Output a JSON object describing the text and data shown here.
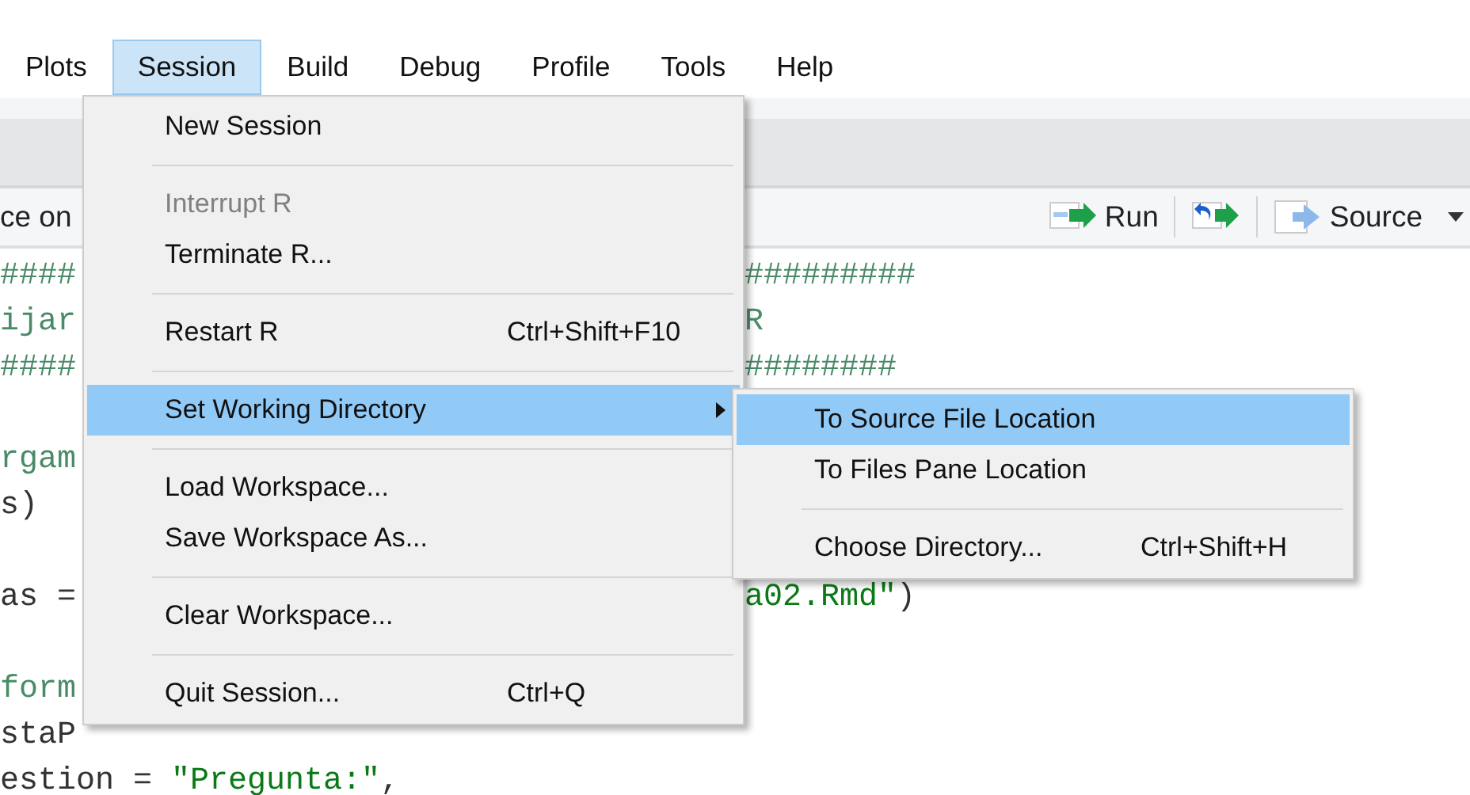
{
  "menubar": [
    {
      "label": "Plots",
      "selected": false
    },
    {
      "label": "Session",
      "selected": true
    },
    {
      "label": "Build",
      "selected": false
    },
    {
      "label": "Debug",
      "selected": false
    },
    {
      "label": "Profile",
      "selected": false
    },
    {
      "label": "Tools",
      "selected": false
    },
    {
      "label": "Help",
      "selected": false
    }
  ],
  "toolbar": {
    "left_text": "ce on",
    "buttons": [
      {
        "kind": "run",
        "label": "Run"
      },
      {
        "kind": "rerun"
      },
      {
        "kind": "source",
        "label": "Source"
      }
    ]
  },
  "editor": {
    "lines": [
      {
        "kind": "code",
        "left": [
          {
            "kind": "comment",
            "text": "####"
          }
        ],
        "right": [
          {
            "kind": "comment",
            "text": "#########"
          }
        ]
      },
      {
        "kind": "code",
        "left": [
          {
            "kind": "comment",
            "text": "ijar"
          }
        ],
        "right": [
          {
            "kind": "comment",
            "text": "R"
          }
        ]
      },
      {
        "kind": "code",
        "left": [
          {
            "kind": "comment",
            "text": "####"
          }
        ],
        "right": [
          {
            "kind": "comment",
            "text": "########"
          }
        ]
      },
      {
        "kind": "blank"
      },
      {
        "kind": "code",
        "left": [
          {
            "kind": "comment",
            "text": "rgam"
          }
        ]
      },
      {
        "kind": "code",
        "left": [
          {
            "kind": "plain",
            "text": "s)"
          }
        ]
      },
      {
        "kind": "blank"
      },
      {
        "kind": "code",
        "left": [
          {
            "kind": "plain",
            "text": "as ="
          }
        ],
        "right": [
          {
            "kind": "string",
            "text": "a02.Rmd\""
          },
          {
            "kind": "plain",
            "text": ")"
          }
        ]
      },
      {
        "kind": "blank"
      },
      {
        "kind": "code",
        "left": [
          {
            "kind": "comment",
            "text": "form"
          }
        ]
      },
      {
        "kind": "code",
        "left": [
          {
            "kind": "plain",
            "text": "staP"
          }
        ]
      },
      {
        "kind": "code",
        "left": [
          {
            "kind": "plain",
            "text": "estion = "
          },
          {
            "kind": "string",
            "text": "\"Pregunta:\""
          },
          {
            "kind": "plain",
            "text": ","
          }
        ]
      }
    ]
  },
  "session_menu": {
    "items": [
      {
        "kind": "item",
        "label": "New Session",
        "disabled": false,
        "selected": false
      },
      {
        "kind": "separator"
      },
      {
        "kind": "item",
        "label": "Interrupt R",
        "disabled": true,
        "selected": false
      },
      {
        "kind": "item",
        "label": "Terminate R...",
        "disabled": false,
        "selected": false
      },
      {
        "kind": "separator"
      },
      {
        "kind": "item",
        "label": "Restart R",
        "shortcut": "Ctrl+Shift+F10",
        "disabled": false,
        "selected": false
      },
      {
        "kind": "separator"
      },
      {
        "kind": "submenu",
        "label": "Set Working Directory",
        "disabled": false,
        "selected": true
      },
      {
        "kind": "separator"
      },
      {
        "kind": "item",
        "label": "Load Workspace...",
        "disabled": false,
        "selected": false
      },
      {
        "kind": "item",
        "label": "Save Workspace As...",
        "disabled": false,
        "selected": false
      },
      {
        "kind": "separator"
      },
      {
        "kind": "item",
        "label": "Clear Workspace...",
        "disabled": false,
        "selected": false
      },
      {
        "kind": "separator"
      },
      {
        "kind": "item",
        "label": "Quit Session...",
        "shortcut": "Ctrl+Q",
        "disabled": false,
        "selected": false
      }
    ]
  },
  "working_directory_submenu": {
    "items": [
      {
        "kind": "item",
        "label": "To Source File Location",
        "disabled": false,
        "selected": true
      },
      {
        "kind": "item",
        "label": "To Files Pane Location",
        "disabled": false,
        "selected": false
      },
      {
        "kind": "separator"
      },
      {
        "kind": "item",
        "label": "Choose Directory...",
        "shortcut": "Ctrl+Shift+H",
        "disabled": false,
        "selected": false
      }
    ]
  }
}
